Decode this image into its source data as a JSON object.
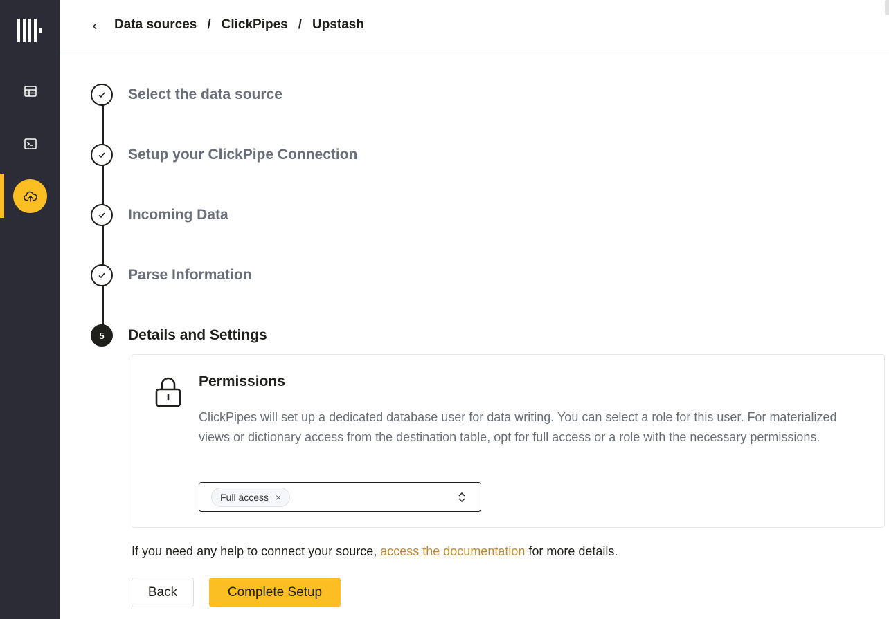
{
  "sidebar": {
    "logo_icon": "clickhouse-logo-icon",
    "items": [
      {
        "icon": "table-icon",
        "active": false
      },
      {
        "icon": "terminal-icon",
        "active": false
      },
      {
        "icon": "cloud-upload-icon",
        "active": true
      }
    ],
    "accent_color": "#fbbf24"
  },
  "breadcrumb": {
    "back_icon": "chevron-left-icon",
    "items": [
      "Data sources",
      "ClickPipes",
      "Upstash"
    ],
    "separator": "/"
  },
  "steps": [
    {
      "label": "Select the data source",
      "status": "complete"
    },
    {
      "label": "Setup your ClickPipe Connection",
      "status": "complete"
    },
    {
      "label": "Incoming Data",
      "status": "complete"
    },
    {
      "label": "Parse Information",
      "status": "complete"
    },
    {
      "label": "Details and Settings",
      "status": "current",
      "number": "5"
    }
  ],
  "permissions": {
    "icon": "lock-icon",
    "title": "Permissions",
    "description": "ClickPipes will set up a dedicated database user for data writing. You can select a role for this user. For materialized views or dictionary access from the destination table, opt for full access or a role with the necessary permissions.",
    "selected_role": "Full access",
    "remove_glyph": "×"
  },
  "help": {
    "prefix": "If you need any help to connect your source, ",
    "link_text": "access the documentation",
    "suffix": " for more details."
  },
  "buttons": {
    "back_label": "Back",
    "complete_label": "Complete Setup"
  }
}
